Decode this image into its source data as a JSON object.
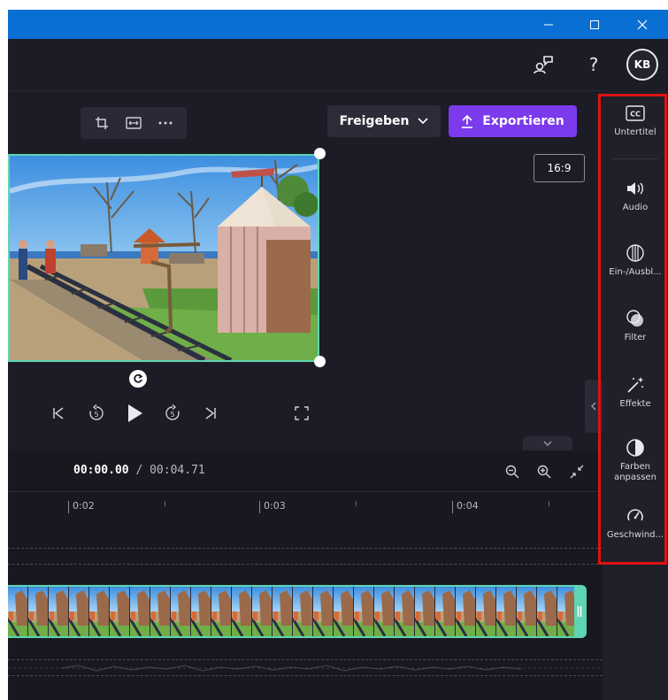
{
  "window": {
    "minimize_glyph": "—",
    "maximize_glyph": "▢",
    "close_glyph": "✕"
  },
  "header": {
    "help_label": "?",
    "avatar_initials": "KB"
  },
  "preview": {
    "share_label": "Freigeben",
    "export_label": "Exportieren",
    "aspect_ratio": "16:9"
  },
  "playback": {
    "current_time": "00:00.00",
    "separator": " / ",
    "total_time": "00:04.71"
  },
  "timeline": {
    "ticks": [
      "0:02",
      "0:03",
      "0:04"
    ]
  },
  "sidepanel": {
    "items": [
      {
        "label": "Untertitel",
        "icon": "cc-icon"
      },
      {
        "label": "Audio",
        "icon": "speaker-icon"
      },
      {
        "label": "Ein-/Ausbl...",
        "icon": "fade-icon"
      },
      {
        "label": "Filter",
        "icon": "filter-icon"
      },
      {
        "label": "Effekte",
        "icon": "magic-wand-icon"
      },
      {
        "label": "Farben anpassen",
        "icon": "contrast-icon"
      },
      {
        "label": "Geschwind...",
        "icon": "speedometer-icon"
      }
    ]
  },
  "colors": {
    "titlebar": "#0a6fd3",
    "accent": "#7c3aed",
    "selection": "#5fd4b2",
    "highlight": "#e01212"
  }
}
